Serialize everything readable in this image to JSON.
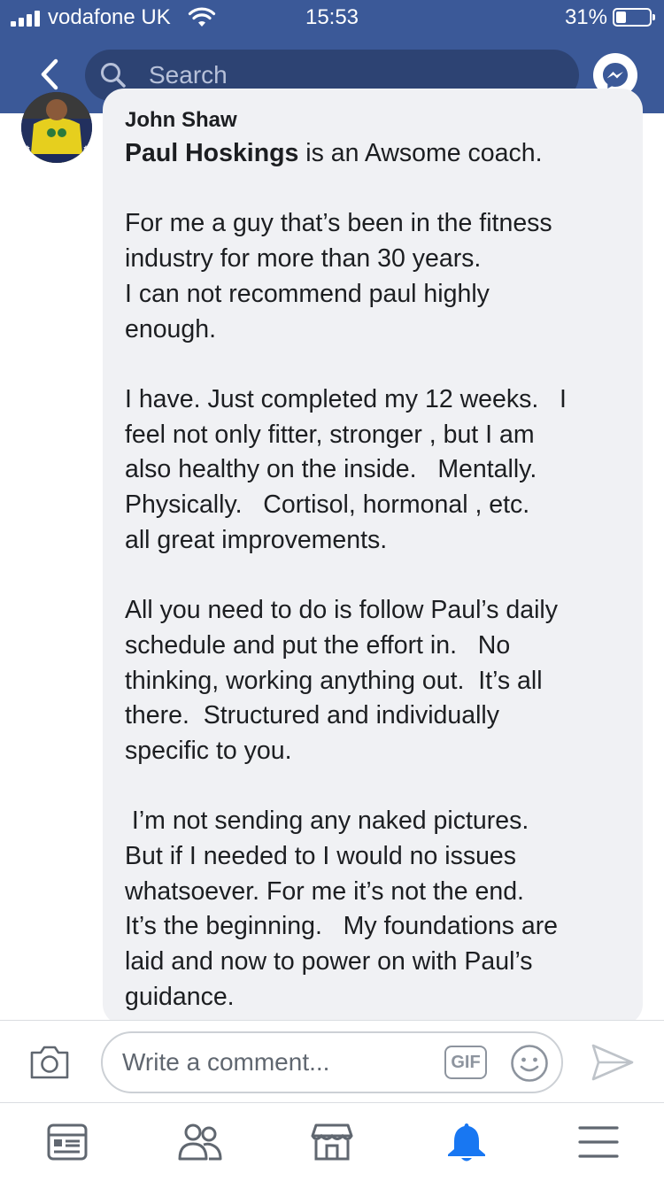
{
  "status_bar": {
    "carrier": "vodafone UK",
    "time": "15:53",
    "battery_percent": "31%",
    "battery_level": 0.31,
    "signal_bars": 4
  },
  "nav": {
    "search_placeholder": "Search",
    "back_icon": "chevron-left-icon",
    "messenger_icon": "messenger-icon"
  },
  "comment": {
    "author": "John Shaw",
    "mention": "Paul Hoskings",
    "first_line_rest": " is an Awsome coach.",
    "lines": [
      "",
      "For me a guy that’s been in the fitness",
      "industry for more than 30 years.",
      "I can not recommend paul highly",
      "enough.",
      "",
      "I have. Just completed my 12 weeks.   I",
      "feel not only fitter, stronger , but I am",
      "also healthy on the inside.   Mentally.",
      "Physically.   Cortisol, hormonal , etc.",
      "all great improvements.",
      "",
      "All you need to do is follow Paul’s daily",
      "schedule and put the effort in.   No",
      "thinking, working anything out.  It’s all",
      "there.  Structured and individually",
      "specific to you.",
      "",
      " I’m not sending any naked pictures.",
      "But if I needed to I would no issues",
      "whatsoever. For me it’s not the end.",
      "It’s the beginning.   My foundations are",
      "laid and now to power on with Paul’s",
      "guidance."
    ]
  },
  "composer": {
    "placeholder": "Write a comment...",
    "gif_label": "GIF"
  },
  "tabbar": {
    "items": [
      "news-feed-icon",
      "groups-icon",
      "marketplace-icon",
      "notifications-icon",
      "menu-icon"
    ],
    "active": "notifications-icon"
  },
  "colors": {
    "brand": "#3b5998",
    "search_bg": "#2d4373",
    "bubble": "#f0f1f4",
    "active_tab": "#1877f2",
    "icon_gray": "#606770"
  }
}
